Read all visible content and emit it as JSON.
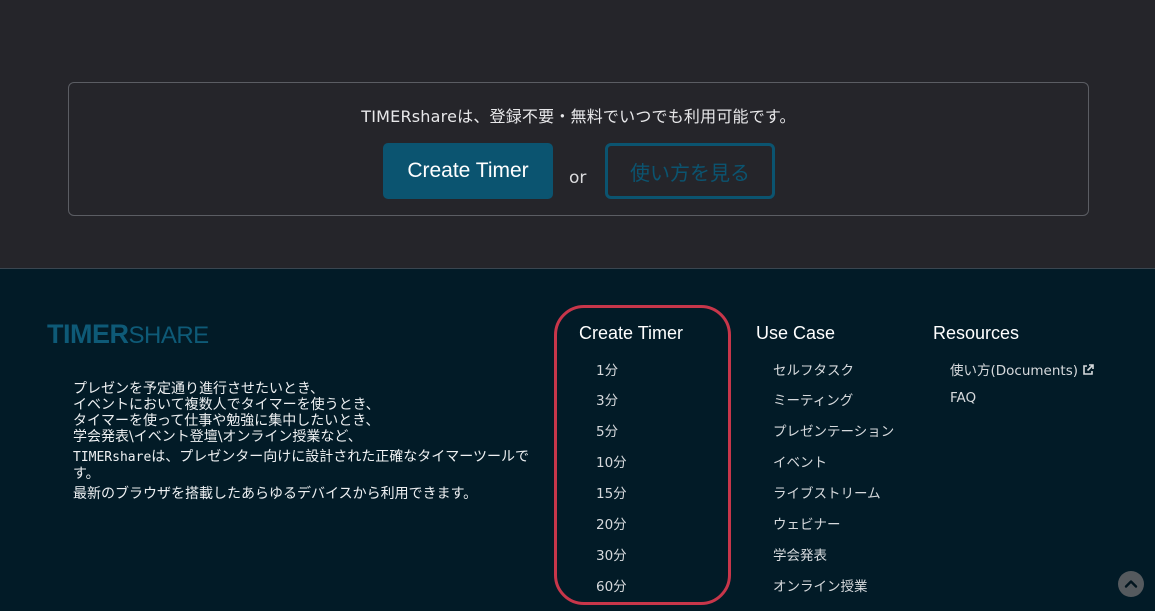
{
  "cta": {
    "text": "TIMERshareは、登録不要・無料でいつでも利用可能です。",
    "create_button": "Create Timer",
    "or_text": "or",
    "howto_button": "使い方を見る"
  },
  "footer": {
    "logo_bold": "TIMER",
    "logo_light": "SHARE",
    "description": {
      "lines": [
        "プレゼンを予定通り進行させたいとき、",
        "イベントにおいて複数人でタイマーを使うとき、",
        "タイマーを使って仕事や勉強に集中したいとき、",
        "学会発表\\イベント登壇\\オンライン授業など、"
      ],
      "mono_prefix": "TIMERshare",
      "sentence2": "は、プレゼンター向けに設計された正確なタイマーツールです。",
      "sentence3": "最新のブラウザを搭載したあらゆるデバイスから利用できます。"
    },
    "create_timer": {
      "title": "Create Timer",
      "items": [
        "1分",
        "3分",
        "5分",
        "10分",
        "15分",
        "20分",
        "30分",
        "60分"
      ]
    },
    "use_case": {
      "title": "Use Case",
      "items": [
        "セルフタスク",
        "ミーティング",
        "プレゼンテーション",
        "イベント",
        "ライブストリーム",
        "ウェビナー",
        "学会発表",
        "オンライン授業"
      ]
    },
    "resources": {
      "title": "Resources",
      "items": [
        "使い方(Documents)",
        "FAQ"
      ]
    }
  },
  "icons": {
    "external_link": "external-link-icon",
    "scroll_top": "chevron-up-icon"
  },
  "colors": {
    "top_background": "#25252a",
    "footer_background": "#021b27",
    "accent": "#0b5470",
    "highlight": "#c7364a"
  }
}
